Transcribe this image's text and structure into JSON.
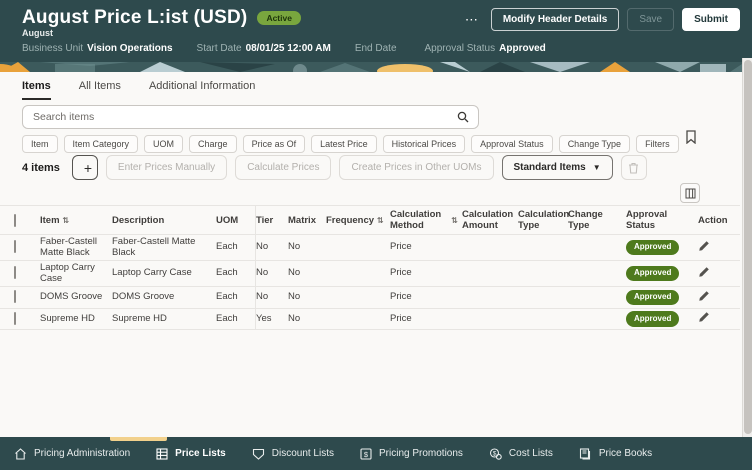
{
  "colors": {
    "header_bg": "#2E4A4D",
    "accent_yellow": "#F2D18C",
    "active_badge_green": "#79A63E",
    "approved_badge_green": "#4E7A1D"
  },
  "header": {
    "title": "August Price L:ist (USD)",
    "status_badge": "Active",
    "subtitle": "August",
    "meta": [
      {
        "label": "Business Unit",
        "value": "Vision Operations"
      },
      {
        "label": "Start Date",
        "value": "08/01/25 12:00 AM"
      },
      {
        "label": "End Date",
        "value": ""
      },
      {
        "label": "Approval Status",
        "value": "Approved"
      }
    ],
    "actions": {
      "modify": "Modify Header Details",
      "save": "Save",
      "submit": "Submit"
    }
  },
  "tabs": [
    {
      "label": "Items"
    },
    {
      "label": "All Items"
    },
    {
      "label": "Additional Information"
    }
  ],
  "search": {
    "placeholder": "Search items"
  },
  "filter_chips": [
    "Item",
    "Item Category",
    "UOM",
    "Charge",
    "Price as Of",
    "Latest Price",
    "Historical Prices",
    "Approval Status",
    "Change Type",
    "Filters"
  ],
  "toolbar": {
    "count": "4 items",
    "buttons": [
      "Enter Prices Manually",
      "Calculate Prices",
      "Create Prices in Other UOMs"
    ],
    "dropdown": "Standard Items"
  },
  "table": {
    "columns": [
      "Item",
      "Description",
      "UOM",
      "Tier",
      "Matrix",
      "Frequency",
      "Calculation Method",
      "Calculation Amount",
      "Calculation Type",
      "Change Type",
      "Approval Status",
      "Action"
    ],
    "rows": [
      {
        "item": "Faber-Castell Matte Black",
        "description": "Faber-Castell Matte Black",
        "uom": "Each",
        "tier": "No",
        "matrix": "No",
        "frequency": "",
        "calc_method": "Price",
        "calc_amount": "",
        "calc_type": "",
        "change_type": "",
        "approval_status": "Approved"
      },
      {
        "item": "Laptop Carry Case",
        "description": "Laptop Carry Case",
        "uom": "Each",
        "tier": "No",
        "matrix": "No",
        "frequency": "",
        "calc_method": "Price",
        "calc_amount": "",
        "calc_type": "",
        "change_type": "",
        "approval_status": "Approved"
      },
      {
        "item": "DOMS Groove",
        "description": "DOMS Groove",
        "uom": "Each",
        "tier": "No",
        "matrix": "No",
        "frequency": "",
        "calc_method": "Price",
        "calc_amount": "",
        "calc_type": "",
        "change_type": "",
        "approval_status": "Approved"
      },
      {
        "item": "Supreme HD",
        "description": "Supreme HD",
        "uom": "Each",
        "tier": "Yes",
        "matrix": "No",
        "frequency": "",
        "calc_method": "Price",
        "calc_amount": "",
        "calc_type": "",
        "change_type": "",
        "approval_status": "Approved"
      }
    ]
  },
  "footer": {
    "items": [
      {
        "label": "Pricing Administration"
      },
      {
        "label": "Price Lists"
      },
      {
        "label": "Discount Lists"
      },
      {
        "label": "Pricing Promotions"
      },
      {
        "label": "Cost Lists"
      },
      {
        "label": "Price Books"
      }
    ]
  }
}
